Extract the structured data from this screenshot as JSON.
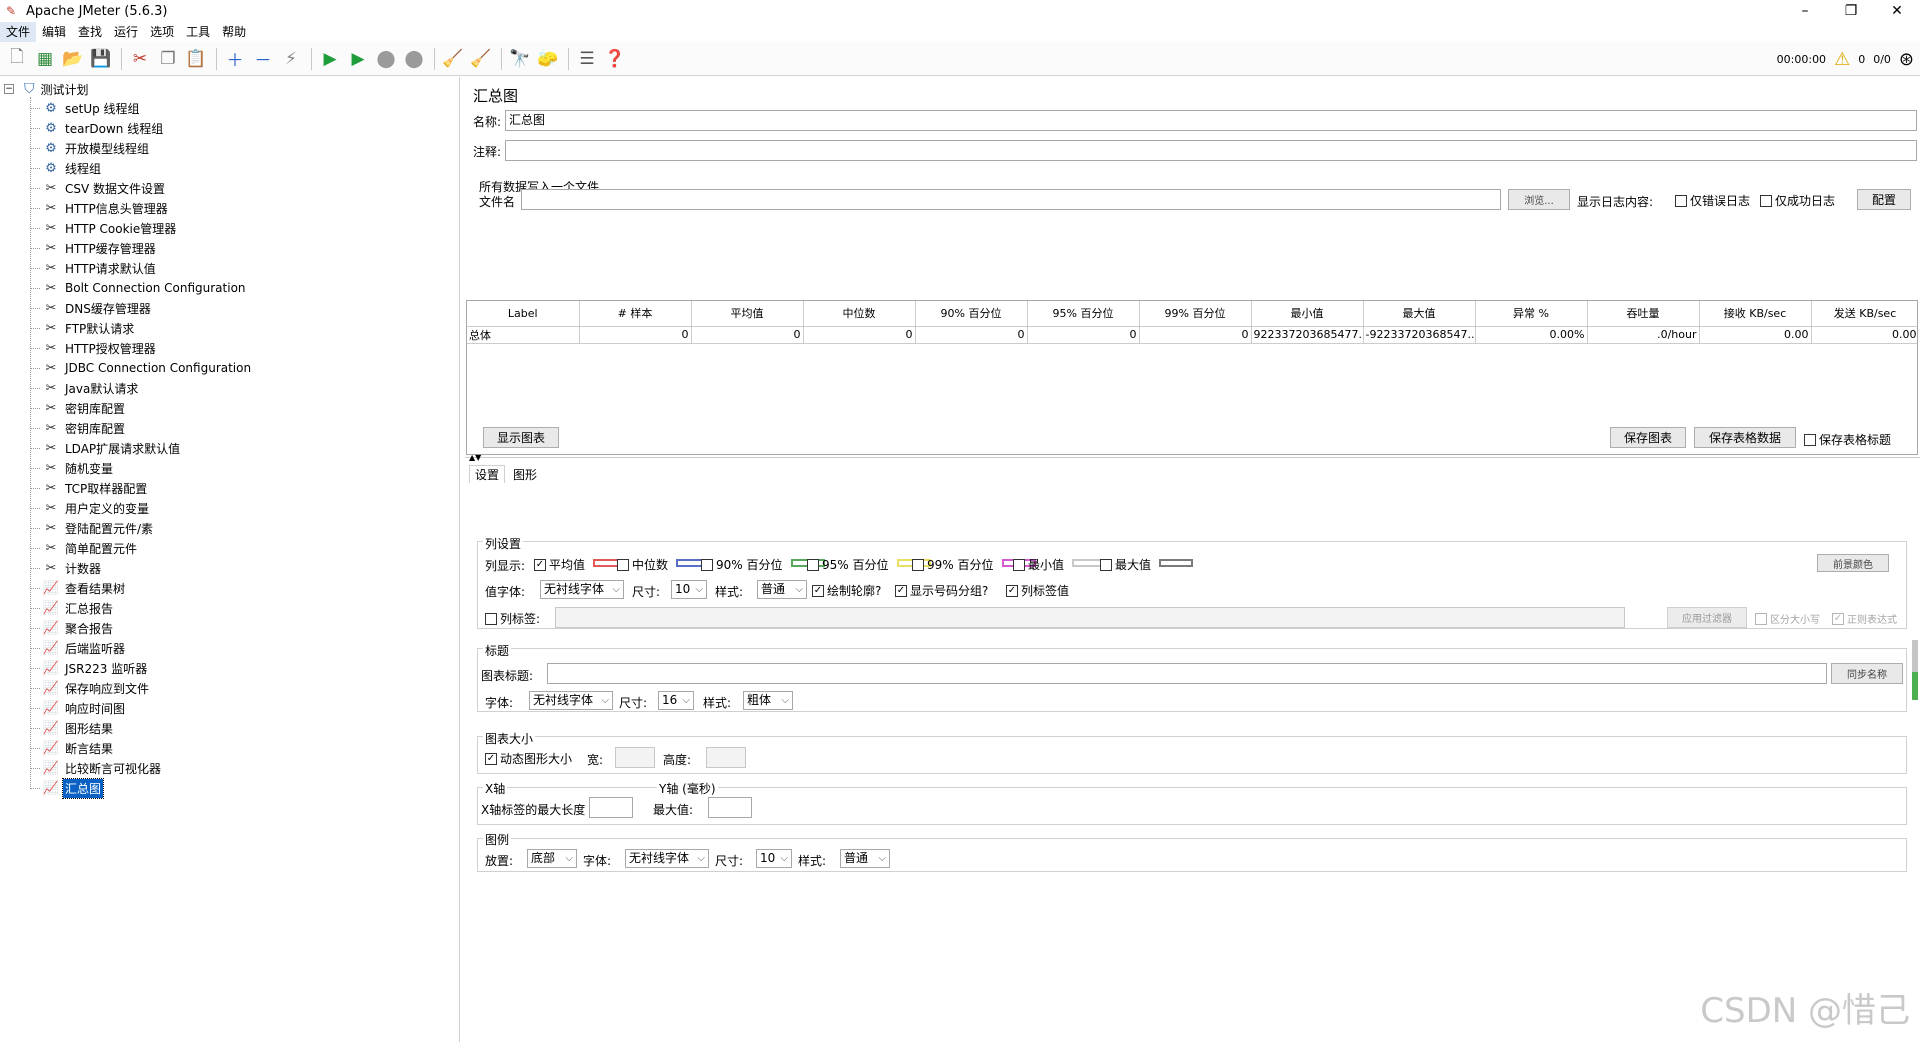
{
  "window": {
    "title": "Apache JMeter (5.6.3)",
    "minimize": "–",
    "maximize": "❐",
    "close": "✕"
  },
  "menu": [
    "文件",
    "编辑",
    "查找",
    "运行",
    "选项",
    "工具",
    "帮助"
  ],
  "toolbar": {
    "timer": "00:00:00",
    "warning_count": "0",
    "threads": "0/0"
  },
  "tree": {
    "root": "测试计划",
    "items": [
      {
        "label": "setUp 线程组",
        "kind": "thread"
      },
      {
        "label": "tearDown 线程组",
        "kind": "thread"
      },
      {
        "label": "开放模型线程组",
        "kind": "thread"
      },
      {
        "label": "线程组",
        "kind": "thread"
      },
      {
        "label": "CSV 数据文件设置",
        "kind": "config"
      },
      {
        "label": "HTTP信息头管理器",
        "kind": "config"
      },
      {
        "label": "HTTP Cookie管理器",
        "kind": "config"
      },
      {
        "label": "HTTP缓存管理器",
        "kind": "config"
      },
      {
        "label": "HTTP请求默认值",
        "kind": "config"
      },
      {
        "label": "Bolt Connection Configuration",
        "kind": "config"
      },
      {
        "label": "DNS缓存管理器",
        "kind": "config"
      },
      {
        "label": "FTP默认请求",
        "kind": "config"
      },
      {
        "label": "HTTP授权管理器",
        "kind": "config"
      },
      {
        "label": "JDBC Connection Configuration",
        "kind": "config"
      },
      {
        "label": "Java默认请求",
        "kind": "config"
      },
      {
        "label": "密钥库配置",
        "kind": "config"
      },
      {
        "label": "密钥库配置",
        "kind": "config"
      },
      {
        "label": "LDAP扩展请求默认值",
        "kind": "config"
      },
      {
        "label": "随机变量",
        "kind": "config"
      },
      {
        "label": "TCP取样器配置",
        "kind": "config"
      },
      {
        "label": "用户定义的变量",
        "kind": "config"
      },
      {
        "label": "登陆配置元件/素",
        "kind": "config"
      },
      {
        "label": "简单配置元件",
        "kind": "config"
      },
      {
        "label": "计数器",
        "kind": "config"
      },
      {
        "label": "查看结果树",
        "kind": "listener"
      },
      {
        "label": "汇总报告",
        "kind": "listener"
      },
      {
        "label": "聚合报告",
        "kind": "listener"
      },
      {
        "label": "后端监听器",
        "kind": "listener"
      },
      {
        "label": "JSR223 监听器",
        "kind": "listener"
      },
      {
        "label": "保存响应到文件",
        "kind": "listener"
      },
      {
        "label": "响应时间图",
        "kind": "listener"
      },
      {
        "label": "图形结果",
        "kind": "listener"
      },
      {
        "label": "断言结果",
        "kind": "listener"
      },
      {
        "label": "比较断言可视化器",
        "kind": "listener"
      },
      {
        "label": "汇总图",
        "kind": "listener",
        "selected": true
      }
    ]
  },
  "panel": {
    "title": "汇总图",
    "name_label": "名称:",
    "name_value": "汇总图",
    "comment_label": "注释:",
    "comment_value": "",
    "file_section_title": "所有数据写入一个文件",
    "file_label": "文件名",
    "browse_button": "浏览...",
    "log_label": "显示日志内容:",
    "errors_only": "仅错误日志",
    "success_only": "仅成功日志",
    "configure_button": "配置"
  },
  "table": {
    "headers": [
      "Label",
      "# 样本",
      "平均值",
      "中位数",
      "90% 百分位",
      "95% 百分位",
      "99% 百分位",
      "最小值",
      "最大值",
      "异常 %",
      "吞吐量",
      "接收 KB/sec",
      "发送 KB/sec"
    ],
    "rows": [
      [
        "总体",
        "0",
        "0",
        "0",
        "0",
        "0",
        "0",
        "922337203685477...",
        "-92233720368547...",
        "0.00%",
        ".0/hour",
        "0.00",
        "0.00"
      ]
    ]
  },
  "tabs": [
    "设置",
    "图形"
  ],
  "settings": {
    "show_graph_button": "显示图表",
    "save_graph_button": "保存图表",
    "save_table_button": "保存表格数据",
    "save_table_header": "保存表格标题",
    "columns_section": "列设置",
    "columns_label": "列显示:",
    "columns": [
      {
        "label": "平均值",
        "checked": true,
        "color": "#e05a5a"
      },
      {
        "label": "中位数",
        "checked": false,
        "color": "#5a6ec8"
      },
      {
        "label": "90% 百分位",
        "checked": false,
        "color": "#5aa85a"
      },
      {
        "label": "95% 百分位",
        "checked": false,
        "color": "#e8e060"
      },
      {
        "label": "99% 百分位",
        "checked": false,
        "color": "#d45ad4"
      },
      {
        "label": "最小值",
        "checked": false,
        "color": "#c8c8c8"
      },
      {
        "label": "最大值",
        "checked": false,
        "color": "#7a7a7a"
      }
    ],
    "foreground_color_button": "前景颜色",
    "value_font_label": "值字体:",
    "value_font": "无衬线字体",
    "size_label": "尺寸:",
    "value_size": "10",
    "style_label": "样式:",
    "value_style": "普通",
    "draw_outline": "绘制轮廓?",
    "show_number_grouping": "显示号码分组?",
    "column_label_value": "列标签值",
    "column_label_filter": "列标签:",
    "apply_filter_button": "应用过滤器",
    "case_sensitive": "区分大小写",
    "regex": "正则表达式",
    "title_section": "标题",
    "graph_title_label": "图表标题:",
    "sync_name_button": "同步名称",
    "font_label": "字体:",
    "title_font": "无衬线字体",
    "title_size": "16",
    "title_style": "粗体",
    "size_section": "图表大小",
    "dynamic_size": "动态图形大小",
    "width_label": "宽:",
    "height_label": "高度:",
    "xaxis_section": "X轴",
    "xaxis_max_label": "X轴标签的最大长度",
    "yaxis_section": "Y轴 (毫秒)",
    "yaxis_max_label": "最大值:",
    "legend_section": "图例",
    "placement_label": "放置:",
    "legend_placement": "底部",
    "legend_font": "无衬线字体",
    "legend_size": "10",
    "legend_style": "普通"
  },
  "watermark": "CSDN @惜己"
}
